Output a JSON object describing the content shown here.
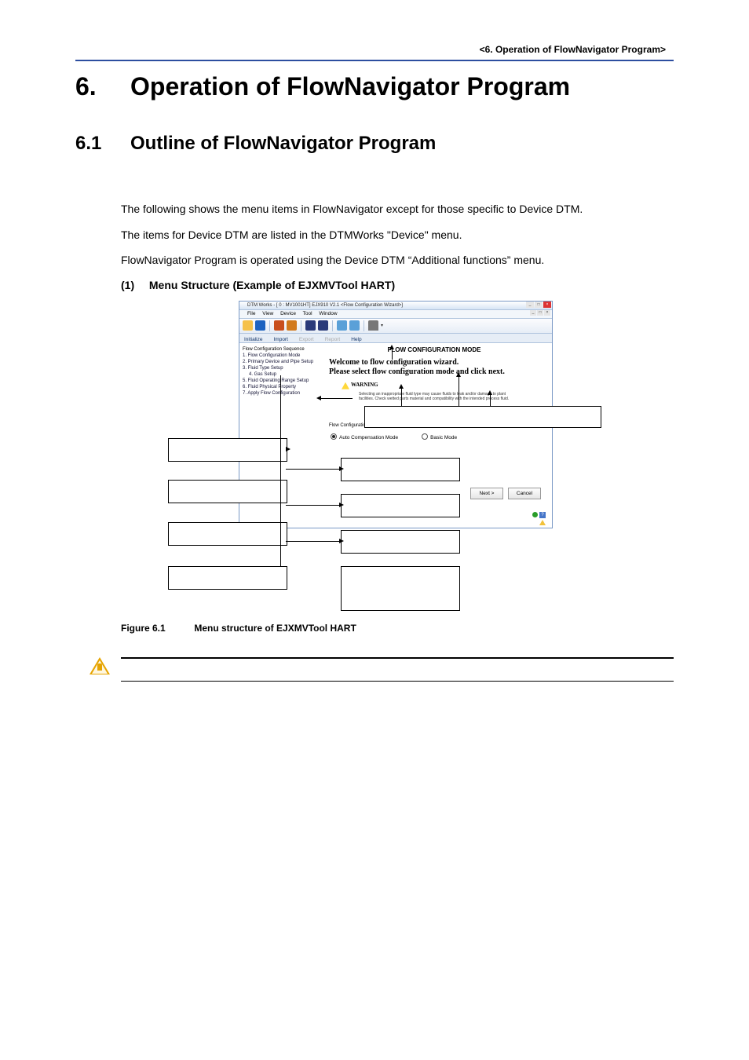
{
  "running_head": "<6.  Operation of FlowNavigator Program>",
  "chapter": {
    "num": "6.",
    "title": "Operation of FlowNavigator Program"
  },
  "section": {
    "num": "6.1",
    "title": "Outline of FlowNavigator Program"
  },
  "paragraphs": [
    "The following shows the menu items in FlowNavigator except for those specific to Device DTM.",
    "The items for Device DTM are listed in the DTMWorks \"Device\" menu.",
    "FlowNavigator Program is operated using the Device DTM “Additional functions” menu."
  ],
  "sub_head": {
    "idx": "(1)",
    "text": "Menu Structure (Example of EJXMVTool HART)"
  },
  "figure_caption": {
    "label": "Figure 6.1",
    "text": "Menu structure of EJXMVTool HART"
  },
  "app": {
    "title": "DTM Works - [ 0 : MV1001HT] EJX910 V2.1 <Flow Configuration Wizard>]",
    "menubar": [
      "File",
      "View",
      "Device",
      "Tool",
      "Window"
    ],
    "tabs": {
      "active1": "Initialize",
      "active2": "Import",
      "disabled1": "Export",
      "disabled2": "Report",
      "help": "Help"
    },
    "sidebar": {
      "header": "Flow Configuration Sequence",
      "items": [
        "1. Flow Configuration Mode",
        "2. Primary Device and Pipe Setup",
        "3. Fluid Type Setup",
        "4. Gas Setup",
        "5. Fluid Operating Range Setup",
        "6. Fluid Physical Property",
        "7. Apply Flow Configuration"
      ]
    },
    "content": {
      "mode_title": "FLOW CONFIGURATION MODE",
      "welcome_line1": "Welcome to flow configuration wizard.",
      "welcome_line2": "Please select flow configuration mode and click next.",
      "warning_label": "WARNING",
      "warning_small": "Selecting an inappropriate fluid type may cause fluids to leak and/or damage to plant facilities. Check wetted parts material and compatibility with the intended process fluid.",
      "mode_group_label": "Flow Configuration Mode",
      "mode_option_auto": "Auto Compensation Mode",
      "mode_option_basic": "Basic Mode",
      "btn_next": "Next >",
      "btn_cancel": "Cancel"
    }
  }
}
